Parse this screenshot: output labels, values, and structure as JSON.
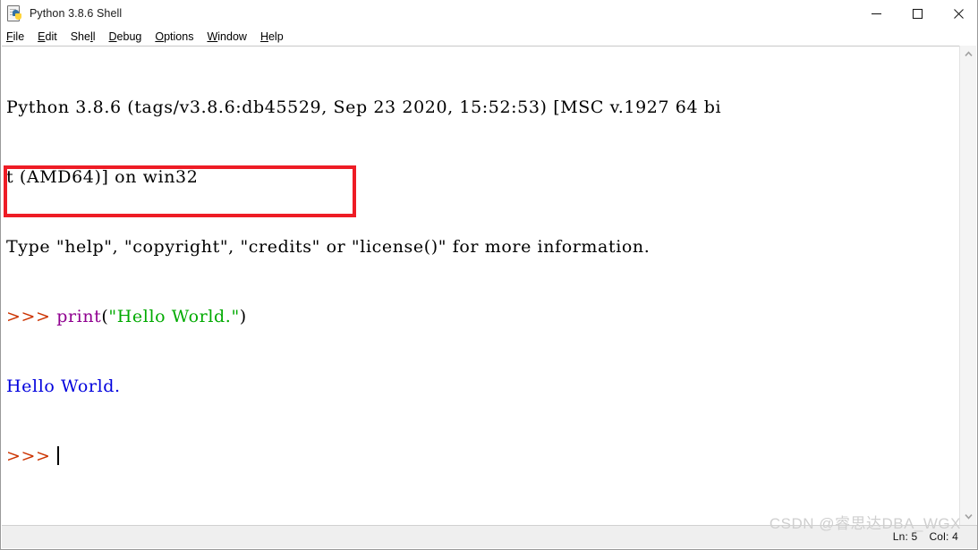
{
  "window": {
    "title": "Python 3.8.6 Shell",
    "icon": "python-file-icon",
    "controls": {
      "minimize": "minimize-icon",
      "maximize": "maximize-icon",
      "close": "close-icon"
    }
  },
  "menubar": {
    "items": [
      {
        "label": "File",
        "mnemonic_before": "",
        "mnemonic": "F",
        "mnemonic_after": "ile"
      },
      {
        "label": "Edit",
        "mnemonic_before": "",
        "mnemonic": "E",
        "mnemonic_after": "dit"
      },
      {
        "label": "Shell",
        "mnemonic_before": "She",
        "mnemonic": "l",
        "mnemonic_after": "l"
      },
      {
        "label": "Debug",
        "mnemonic_before": "",
        "mnemonic": "D",
        "mnemonic_after": "ebug"
      },
      {
        "label": "Options",
        "mnemonic_before": "",
        "mnemonic": "O",
        "mnemonic_after": "ptions"
      },
      {
        "label": "Window",
        "mnemonic_before": "",
        "mnemonic": "W",
        "mnemonic_after": "indow"
      },
      {
        "label": "Help",
        "mnemonic_before": "",
        "mnemonic": "H",
        "mnemonic_after": "elp"
      }
    ]
  },
  "shell": {
    "banner_line1": "Python 3.8.6 (tags/v3.8.6:db45529, Sep 23 2020, 15:52:53) [MSC v.1927 64 bi",
    "banner_line2": "t (AMD64)] on win32",
    "banner_line3": "Type \"help\", \"copyright\", \"credits\" or \"license()\" for more information.",
    "prompt": ">>>",
    "command": {
      "func": "print",
      "open_paren": "(",
      "string": "\"Hello World.\"",
      "close_paren": ")"
    },
    "output": "Hello World.",
    "caret_visible": true
  },
  "annotation": {
    "box_color": "#ee1c25",
    "label": "highlighted-command-and-output"
  },
  "scrollbar": {
    "up_arrow": "chevron-up-icon",
    "down_arrow": "chevron-down-icon"
  },
  "statusbar": {
    "line_label": "Ln: 5",
    "col_label": "Col: 4"
  },
  "watermark": {
    "text": "CSDN @睿思达DBA_WGX",
    "color": "#cfcfcf"
  },
  "colors": {
    "prompt": "#cc3300",
    "builtin": "#900090",
    "string": "#00aa00",
    "output": "#0000dd",
    "plain": "#000000"
  }
}
